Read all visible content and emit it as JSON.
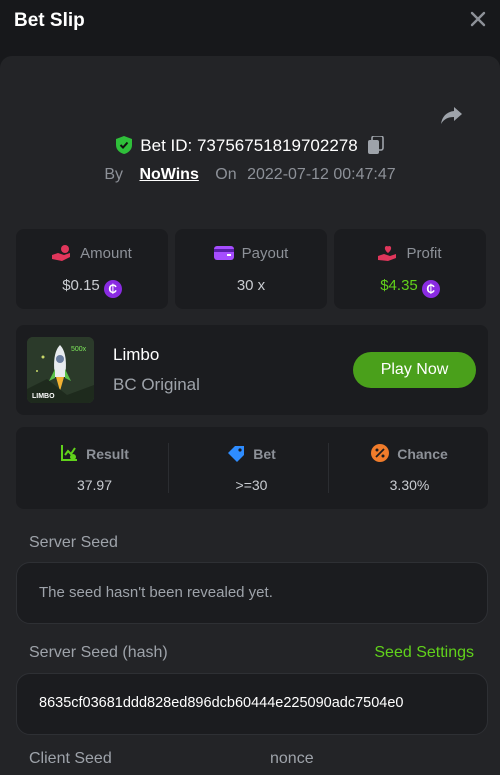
{
  "header": {
    "title": "Bet Slip"
  },
  "bet": {
    "id_text": "Bet ID: 73756751819702278",
    "by_label": "By",
    "username": "NoWins",
    "on_label": "On",
    "datetime": "2022-07-12 00:47:47"
  },
  "stats": [
    {
      "label": "Amount",
      "value": "$0.15",
      "icon": "hand-coin-icon",
      "color": "#e0365b"
    },
    {
      "label": "Payout",
      "value": "30 x",
      "icon": "wallet-icon",
      "color": "#a64dff"
    },
    {
      "label": "Profit",
      "value": "$4.35",
      "icon": "hand-heart-icon",
      "color": "#e0365b"
    }
  ],
  "currency_symbol": "₵",
  "game": {
    "name": "Limbo",
    "subtitle": "BC Original",
    "thumb_label": "LIMBO",
    "thumb_badge": "500x",
    "play_label": "Play Now"
  },
  "results": [
    {
      "label": "Result",
      "value": "37.97",
      "icon": "chart-check-icon",
      "color": "#61d21b"
    },
    {
      "label": "Bet",
      "value": ">=30",
      "icon": "tag-icon",
      "color": "#2e8cff"
    },
    {
      "label": "Chance",
      "value": "3.30%",
      "icon": "percent-icon",
      "color": "#f07c2b"
    }
  ],
  "server_seed": {
    "label": "Server Seed",
    "value": "The seed hasn't been revealed yet."
  },
  "server_seed_hash": {
    "label": "Server Seed (hash)",
    "link": "Seed Settings",
    "value": "8635cf03681ddd828ed896dcb60444e225090adc7504e0"
  },
  "bottom": {
    "client_seed_label": "Client Seed",
    "nonce_label": "nonce"
  }
}
